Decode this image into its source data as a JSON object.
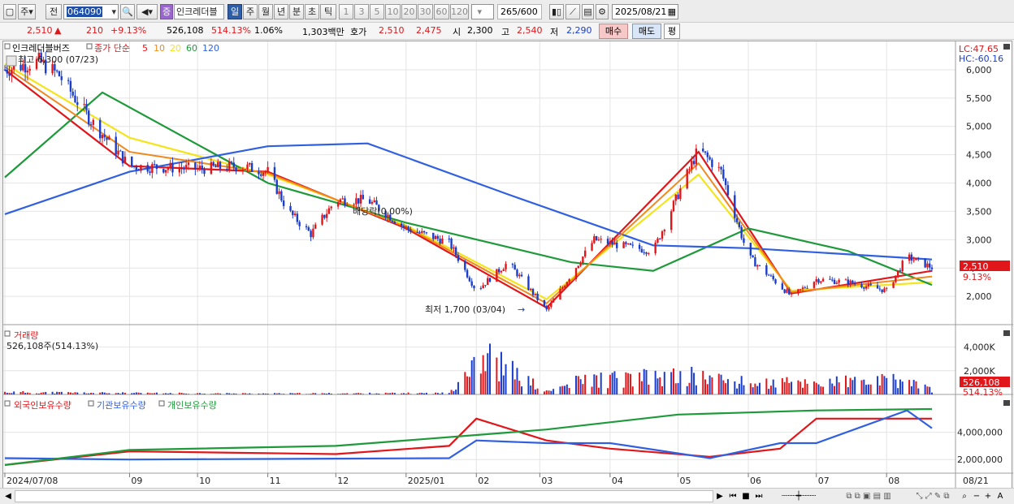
{
  "toolbar": {
    "market_label": "주",
    "prev_label": "전",
    "stock_code": "064090",
    "badge_label": "증",
    "stock_name": "인크레더블",
    "periods": [
      "일",
      "주",
      "월",
      "년",
      "분",
      "초",
      "틱"
    ],
    "active_period": "일",
    "counts": [
      "1",
      "3",
      "5",
      "10",
      "20",
      "30",
      "60",
      "120"
    ],
    "range_value": "265",
    "range_total": "/600",
    "date_value": "2025/08/21"
  },
  "quote": {
    "price": "2,510",
    "arrow": "▲",
    "change": "210",
    "change_pct": "+9.13%",
    "volume": "526,108",
    "volume_ratio": "514.13%",
    "turnover_pct": "1.06%",
    "amount": "1,303백만",
    "ask_label": "호가",
    "ask1": "2,510",
    "ask2": "2,475",
    "open_label": "시",
    "open": "2,300",
    "high_label": "고",
    "high": "2,540",
    "low_label": "저",
    "low": "2,290",
    "buy_label": "매수",
    "sell_label": "매도",
    "avg_label": "평"
  },
  "price_panel": {
    "stock_label": "인크레더블버즈",
    "ma_label": "종가 단순",
    "ma_periods": [
      "5",
      "10",
      "20",
      "60",
      "120"
    ],
    "high_note": "최고 6,300 (07/23)",
    "low_note": "최저 1,700 (03/04)",
    "ex_dividend_note": "배당락(0.00%)",
    "lc_label": "LC:47.65",
    "hc_label": "HC:-60.16",
    "y_ticks": [
      "6,000",
      "5,500",
      "5,000",
      "4,500",
      "4,000",
      "3,500",
      "3,000",
      "2,500",
      "2,000"
    ],
    "current_price_tag": "2,510",
    "current_pct_tag": "9.13%"
  },
  "volume_panel": {
    "title": "거래량",
    "value_label": "526,108주(514.13%)",
    "y_ticks": [
      "4,000K",
      "2,000K"
    ],
    "current_tag": "526,108",
    "current_pct_tag": "514.13%"
  },
  "holding_panel": {
    "legend": [
      "외국인보유수량",
      "기관보유수량",
      "개인보유수량"
    ],
    "y_ticks": [
      "4,000,000",
      "2,000,000"
    ]
  },
  "x_axis": {
    "labels": [
      "2024/07/08",
      "09",
      "10",
      "11",
      "12",
      "2025/01",
      "02",
      "03",
      "04",
      "05",
      "06",
      "07",
      "08"
    ],
    "right_label": "08/21"
  },
  "colors": {
    "up_candle": "#e0161b",
    "down_candle": "#1a3dcc",
    "ma5": "#e0161b",
    "ma10": "#f08a1c",
    "ma20": "#f4e41c",
    "ma60": "#1e9a3a",
    "ma120": "#3060e0",
    "foreign": "#e0161b",
    "institution": "#3060e0",
    "individual": "#1e9a3a"
  },
  "chart_data": {
    "type": "line",
    "title": "인크레더블버즈",
    "price_series": {
      "name": "종가",
      "x": [
        "2024/07/08",
        "2024/07/23",
        "2024/08/01",
        "2024/08/15",
        "2024/09/01",
        "2024/10/01",
        "2024/10/20",
        "2024/11/01",
        "2024/11/10",
        "2024/11/20",
        "2024/12/01",
        "2024/12/15",
        "2025/01/01",
        "2025/01/20",
        "2025/02/01",
        "2025/02/15",
        "2025/03/04",
        "2025/03/15",
        "2025/03/25",
        "2025/04/05",
        "2025/04/20",
        "2025/05/01",
        "2025/05/10",
        "2025/05/20",
        "2025/06/01",
        "2025/06/20",
        "2025/07/01",
        "2025/07/15",
        "2025/08/01",
        "2025/08/10",
        "2025/08/21"
      ],
      "y": [
        6000,
        6150,
        5900,
        5100,
        4300,
        4250,
        4300,
        4200,
        3500,
        3100,
        3700,
        3700,
        3200,
        2950,
        2100,
        2600,
        1750,
        2400,
        3000,
        2900,
        2800,
        3800,
        4600,
        4200,
        2700,
        2000,
        2300,
        2250,
        2100,
        2700,
        2510
      ]
    },
    "ma_series": [
      {
        "name": "5",
        "x": [
          "2024/07/08",
          "2024/09/01",
          "2024/11/01",
          "2025/01/01",
          "2025/03/04",
          "2025/05/10",
          "2025/06/20",
          "2025/08/21"
        ],
        "y": [
          6000,
          4300,
          4200,
          3200,
          1800,
          4550,
          2050,
          2450
        ]
      },
      {
        "name": "20",
        "x": [
          "2024/07/08",
          "2024/09/01",
          "2024/11/01",
          "2025/01/01",
          "2025/03/04",
          "2025/05/10",
          "2025/06/20",
          "2025/08/21"
        ],
        "y": [
          6100,
          4800,
          4150,
          3250,
          1950,
          4150,
          2100,
          2250
        ]
      },
      {
        "name": "60",
        "x": [
          "2024/07/08",
          "2024/08/20",
          "2024/11/01",
          "2025/01/01",
          "2025/03/15",
          "2025/04/20",
          "2025/06/01",
          "2025/07/15",
          "2025/08/21"
        ],
        "y": [
          4100,
          5600,
          4000,
          3300,
          2600,
          2450,
          3200,
          2800,
          2200
        ]
      },
      {
        "name": "120",
        "x": [
          "2024/07/08",
          "2024/09/01",
          "2024/11/01",
          "2024/12/15",
          "2025/02/15",
          "2025/04/20",
          "2025/06/01",
          "2025/08/21"
        ],
        "y": [
          3450,
          4200,
          4650,
          4700,
          3800,
          2900,
          2850,
          2650
        ]
      }
    ],
    "volume": {
      "name": "거래량",
      "unit": "K",
      "x": [
        "2024/07/08",
        "2024/09/01",
        "2024/11/01",
        "2025/01/20",
        "2025/02/01",
        "2025/03/04",
        "2025/03/20",
        "2025/05/10",
        "2025/06/01",
        "2025/08/10",
        "2025/08/21"
      ],
      "values": [
        250,
        150,
        100,
        150,
        4700,
        300,
        1600,
        2000,
        1200,
        1500,
        526
      ]
    },
    "holdings": [
      {
        "name": "외국인보유수량",
        "x": [
          "2024/07/08",
          "2024/09/01",
          "2024/12/01",
          "2025/01/20",
          "2025/02/01",
          "2025/03/04",
          "2025/04/01",
          "2025/05/15",
          "2025/06/15",
          "2025/07/01",
          "2025/08/21"
        ],
        "y": [
          1600000,
          2600000,
          2400000,
          3000000,
          5000000,
          3400000,
          2800000,
          2200000,
          2800000,
          5000000,
          5000000
        ]
      },
      {
        "name": "기관보유수량",
        "x": [
          "2024/07/08",
          "2024/09/01",
          "2025/01/20",
          "2025/02/01",
          "2025/03/04",
          "2025/04/01",
          "2025/05/15",
          "2025/06/15",
          "2025/07/01",
          "2025/08/10",
          "2025/08/21"
        ],
        "y": [
          2100000,
          2000000,
          2100000,
          3400000,
          3200000,
          3200000,
          2100000,
          3200000,
          3200000,
          5600000,
          4300000
        ]
      },
      {
        "name": "개인보유수량",
        "x": [
          "2024/07/08",
          "2024/09/01",
          "2024/12/01",
          "2025/02/01",
          "2025/03/04",
          "2025/05/01",
          "2025/07/01",
          "2025/08/21"
        ],
        "y": [
          1600000,
          2700000,
          3000000,
          3800000,
          4200000,
          5300000,
          5600000,
          5700000
        ]
      }
    ],
    "ylim": [
      1500,
      6300
    ],
    "grid": true
  }
}
